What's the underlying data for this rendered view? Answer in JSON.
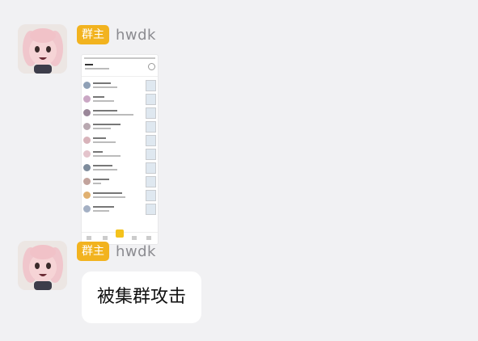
{
  "messages": [
    {
      "role_badge": "群主",
      "nickname": "hwdk",
      "type": "image"
    },
    {
      "role_badge": "群主",
      "nickname": "hwdk",
      "type": "text",
      "text": "被集群攻击"
    }
  ],
  "colors": {
    "background": "#f1f1f3",
    "badge": "#f2b31f",
    "bubble": "#ffffff",
    "nickname": "#8b8b90"
  }
}
